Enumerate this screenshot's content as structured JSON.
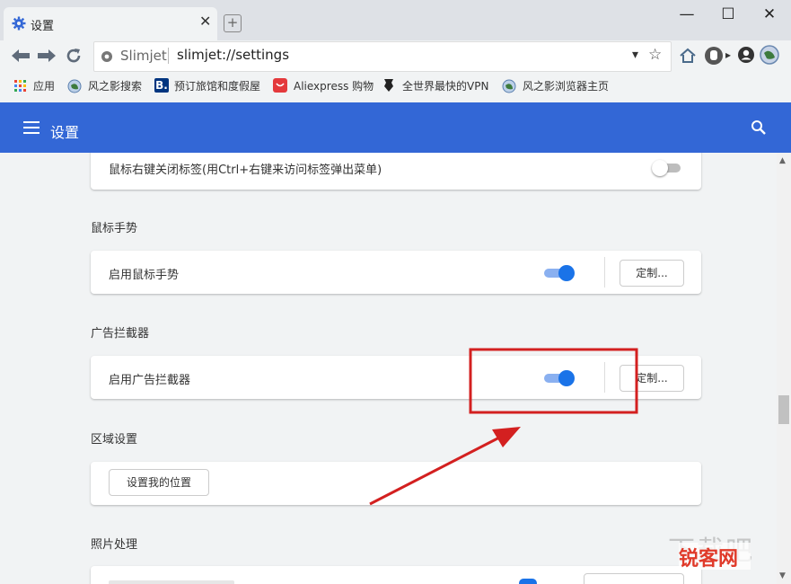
{
  "window": {
    "tab_title": "设置",
    "tab_close": "✕",
    "new_tab": "+",
    "min": "—",
    "max": "☐",
    "close": "✕"
  },
  "address": {
    "site_label": "Slimjet",
    "url": "slimjet://settings",
    "dropdown": "▾",
    "star": "☆"
  },
  "bookmarks": [
    {
      "label": "应用"
    },
    {
      "label": "风之影搜索"
    },
    {
      "label": "预订旅馆和度假屋"
    },
    {
      "label": "Aliexpress 购物"
    },
    {
      "label": "全世界最快的VPN"
    },
    {
      "label": "风之影浏览器主页"
    }
  ],
  "settings_header": {
    "title": "设置"
  },
  "sections": {
    "tab_row": {
      "label": "鼠标右键关闭标签(用Ctrl+右键来访问标签弹出菜单)",
      "enabled": false
    },
    "mouse_gesture": {
      "title": "鼠标手势",
      "row_label": "启用鼠标手势",
      "enabled": true,
      "button": "定制..."
    },
    "ad_blocker": {
      "title": "广告拦截器",
      "row_label": "启用广告拦截器",
      "enabled": true,
      "button": "定制..."
    },
    "region": {
      "title": "区域设置",
      "button": "设置我的位置"
    },
    "photo": {
      "title": "照片处理"
    }
  },
  "watermark": {
    "text": "锐客网",
    "bg_text": "下载吧"
  },
  "colors": {
    "accent": "#3367d6",
    "toggle_on": "#1a73e8",
    "annotation": "#d32020"
  }
}
